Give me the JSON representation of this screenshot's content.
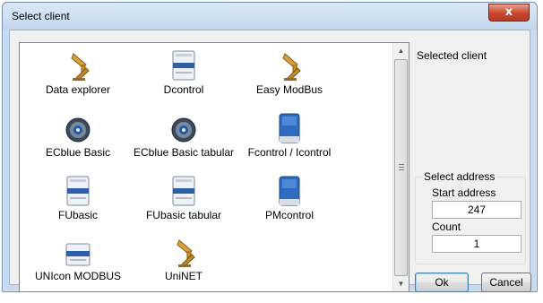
{
  "window": {
    "title": "Select client",
    "close_glyph": "x"
  },
  "clients": [
    {
      "label": "Data explorer",
      "icon": "crane-icon"
    },
    {
      "label": "Dcontrol",
      "icon": "device-icon"
    },
    {
      "label": "Easy ModBus",
      "icon": "crane-icon"
    },
    {
      "label": "ECblue Basic",
      "icon": "fan-icon"
    },
    {
      "label": "ECblue Basic tabular",
      "icon": "fan-icon"
    },
    {
      "label": "Fcontrol / Icontrol",
      "icon": "blue-box-icon"
    },
    {
      "label": "FUbasic",
      "icon": "device-icon"
    },
    {
      "label": "FUbasic tabular",
      "icon": "device-icon"
    },
    {
      "label": "PMcontrol",
      "icon": "blue-box-icon"
    },
    {
      "label": "UNIcon MODBUS",
      "icon": "module-icon"
    },
    {
      "label": "UniNET",
      "icon": "crane-icon"
    }
  ],
  "side": {
    "selected_client_label": "Selected client"
  },
  "address": {
    "group_title": "Select address",
    "start_label": "Start address",
    "start_value": "247",
    "count_label": "Count",
    "count_value": "1"
  },
  "buttons": {
    "ok": "Ok",
    "cancel": "Cancel"
  }
}
